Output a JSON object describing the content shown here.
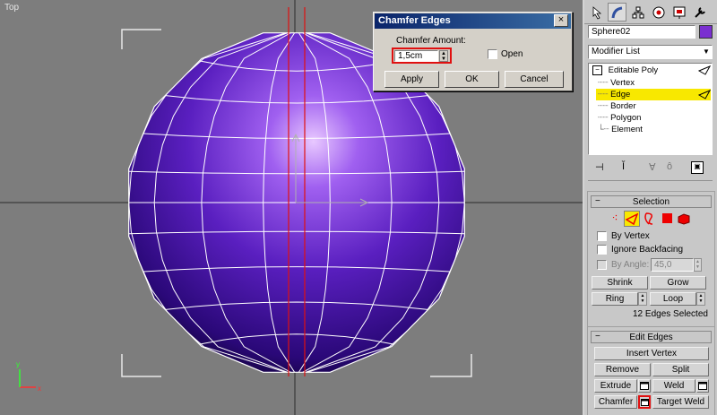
{
  "viewport": {
    "label": "Top",
    "mesh_color": "#5a1fc0",
    "axis_color": "#ff0000"
  },
  "dialog": {
    "title": "Chamfer Edges",
    "close": "×",
    "amount_label": "Chamfer Amount:",
    "amount_value": "1,5cm",
    "open_label": "Open",
    "apply": "Apply",
    "ok": "OK",
    "cancel": "Cancel"
  },
  "panel": {
    "tab_icons": [
      "create-icon",
      "modify-icon",
      "hierarchy-icon",
      "motion-icon",
      "display-icon",
      "utilities-icon"
    ],
    "object_name": "Sphere02",
    "object_color": "#7a2fd0",
    "modifier_list": "Modifier List",
    "stack": {
      "root": "Editable Poly",
      "items": [
        "Vertex",
        "Edge",
        "Border",
        "Polygon",
        "Element"
      ],
      "selected": "Edge"
    },
    "selection": {
      "title": "Selection",
      "by_vertex": "By Vertex",
      "ignore_backfacing": "Ignore Backfacing",
      "by_angle": "By Angle:",
      "angle_value": "45,0",
      "shrink": "Shrink",
      "grow": "Grow",
      "ring": "Ring",
      "loop": "Loop",
      "status": "12 Edges Selected"
    },
    "edit_edges": {
      "title": "Edit Edges",
      "insert_vertex": "Insert Vertex",
      "remove": "Remove",
      "split": "Split",
      "extrude": "Extrude",
      "weld": "Weld",
      "chamfer": "Chamfer",
      "target_weld": "Target Weld"
    }
  }
}
